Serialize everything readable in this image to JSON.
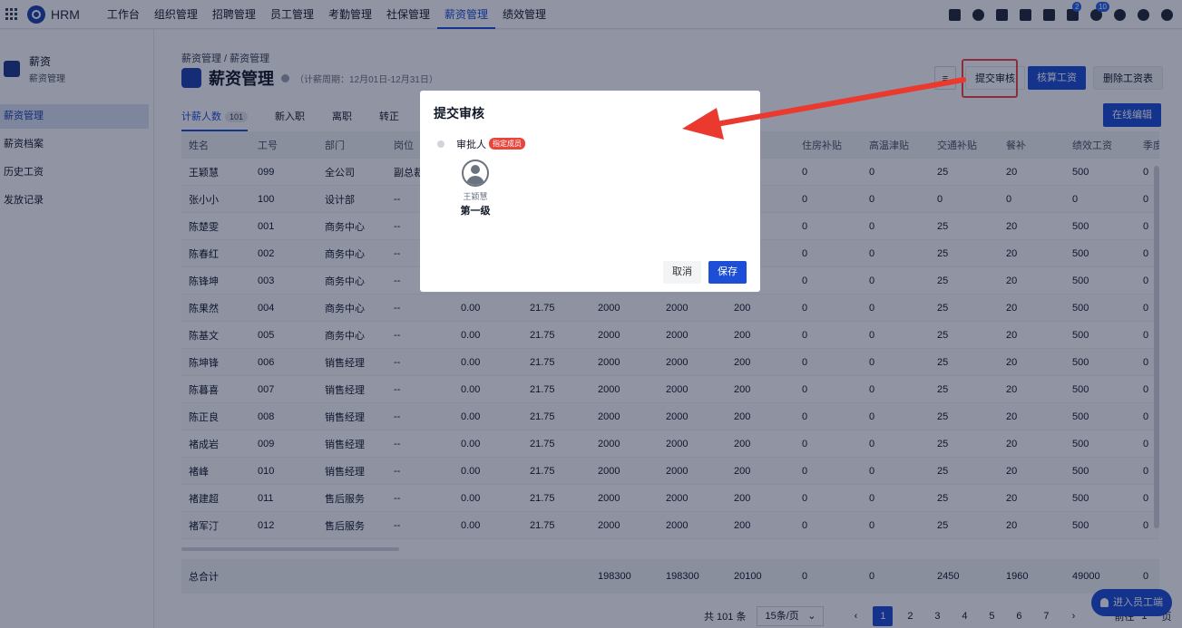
{
  "app": {
    "name": "HRM"
  },
  "topnav": {
    "items": [
      "工作台",
      "组织管理",
      "招聘管理",
      "员工管理",
      "考勤管理",
      "社保管理",
      "薪资管理",
      "绩效管理"
    ],
    "active_index": 6,
    "flag_badge": "2",
    "bell_badge": "10",
    "icons": [
      "calendar-check-icon",
      "user-icon",
      "document-icon",
      "phone-icon",
      "calendar-icon",
      "flag-icon",
      "bell-icon",
      "help-icon",
      "gear-icon",
      "avatar-icon"
    ]
  },
  "sidebar": {
    "title": "薪资",
    "subtitle": "薪资管理",
    "items": [
      "薪资管理",
      "薪资档案",
      "历史工资",
      "发放记录"
    ],
    "active_index": 0
  },
  "page": {
    "breadcrumb": "薪资管理  /  薪资管理",
    "title": "薪资管理",
    "period": "（计薪周期：12月01日-12月31日）"
  },
  "actions": {
    "filter_icon": "≡",
    "submit": "提交审核",
    "calc": "核算工资",
    "delete": "删除工资表",
    "online_edit": "在线编辑"
  },
  "tabs": {
    "items": [
      {
        "label": "计薪人数",
        "count": "101"
      },
      {
        "label": "新入职"
      },
      {
        "label": "离职"
      },
      {
        "label": "转正"
      }
    ],
    "active_index": 0
  },
  "table": {
    "columns": [
      "姓名",
      "工号",
      "部门",
      "岗位",
      "",
      "",
      "",
      "",
      "资",
      "住房补贴",
      "高温津贴",
      "交通补贴",
      "餐补",
      "绩效工资",
      "季度"
    ],
    "rows": [
      [
        "王颖慧",
        "099",
        "全公司",
        "副总裁",
        "",
        "",
        "",
        "",
        "",
        "0",
        "0",
        "25",
        "20",
        "500",
        "0"
      ],
      [
        "张小小",
        "100",
        "设计部",
        "--",
        "",
        "",
        "",
        "",
        "",
        "0",
        "0",
        "0",
        "0",
        "0",
        "0"
      ],
      [
        "陈楚雯",
        "001",
        "商务中心",
        "--",
        "",
        "",
        "",
        "",
        "",
        "0",
        "0",
        "25",
        "20",
        "500",
        "0"
      ],
      [
        "陈春红",
        "002",
        "商务中心",
        "--",
        "",
        "",
        "",
        "",
        "",
        "0",
        "0",
        "25",
        "20",
        "500",
        "0"
      ],
      [
        "陈锋坤",
        "003",
        "商务中心",
        "--",
        "",
        "",
        "",
        "",
        "",
        "0",
        "0",
        "25",
        "20",
        "500",
        "0"
      ],
      [
        "陈果然",
        "004",
        "商务中心",
        "--",
        "0.00",
        "21.75",
        "2000",
        "2000",
        "200",
        "0",
        "0",
        "25",
        "20",
        "500",
        "0"
      ],
      [
        "陈基文",
        "005",
        "商务中心",
        "--",
        "0.00",
        "21.75",
        "2000",
        "2000",
        "200",
        "0",
        "0",
        "25",
        "20",
        "500",
        "0"
      ],
      [
        "陈坤锋",
        "006",
        "销售经理",
        "--",
        "0.00",
        "21.75",
        "2000",
        "2000",
        "200",
        "0",
        "0",
        "25",
        "20",
        "500",
        "0"
      ],
      [
        "陈暮喜",
        "007",
        "销售经理",
        "--",
        "0.00",
        "21.75",
        "2000",
        "2000",
        "200",
        "0",
        "0",
        "25",
        "20",
        "500",
        "0"
      ],
      [
        "陈正良",
        "008",
        "销售经理",
        "--",
        "0.00",
        "21.75",
        "2000",
        "2000",
        "200",
        "0",
        "0",
        "25",
        "20",
        "500",
        "0"
      ],
      [
        "褚成岩",
        "009",
        "销售经理",
        "--",
        "0.00",
        "21.75",
        "2000",
        "2000",
        "200",
        "0",
        "0",
        "25",
        "20",
        "500",
        "0"
      ],
      [
        "褚峰",
        "010",
        "销售经理",
        "--",
        "0.00",
        "21.75",
        "2000",
        "2000",
        "200",
        "0",
        "0",
        "25",
        "20",
        "500",
        "0"
      ],
      [
        "褚建超",
        "011",
        "售后服务",
        "--",
        "0.00",
        "21.75",
        "2000",
        "2000",
        "200",
        "0",
        "0",
        "25",
        "20",
        "500",
        "0"
      ],
      [
        "褚军汀",
        "012",
        "售后服务",
        "--",
        "0.00",
        "21.75",
        "2000",
        "2000",
        "200",
        "0",
        "0",
        "25",
        "20",
        "500",
        "0"
      ]
    ],
    "total": [
      "总合计",
      "",
      "",
      "",
      "",
      "",
      "198300",
      "198300",
      "20100",
      "0",
      "0",
      "2450",
      "1960",
      "49000",
      "0"
    ]
  },
  "pager": {
    "total": "共 101 条",
    "page_size": "15条/页",
    "pages": [
      "1",
      "2",
      "3",
      "4",
      "5",
      "6",
      "7"
    ],
    "active": "1",
    "prev": "‹",
    "next": "›",
    "goto_label": "前往",
    "goto_value": "1",
    "goto_suffix": "页"
  },
  "fab": {
    "label": "进入员工端"
  },
  "modal": {
    "title": "提交审核",
    "approver_label": "审批人",
    "tag": "指定成员",
    "approver_name": "王颖慧",
    "level": "第一级",
    "cancel": "取消",
    "save": "保存"
  },
  "colors": {
    "primary": "#1d4ed8",
    "highlight": "#ef4444",
    "tag": "#e8453c"
  }
}
